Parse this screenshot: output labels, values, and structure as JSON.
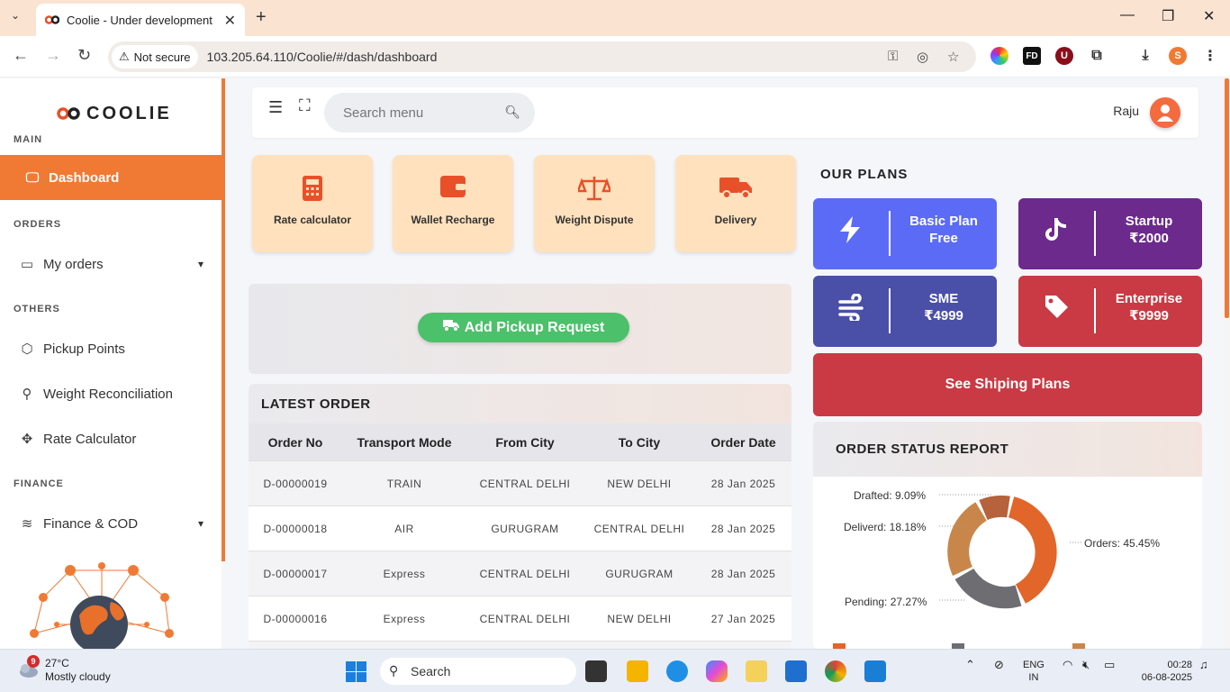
{
  "browser": {
    "tab_title": "Coolie - Under development",
    "security": "Not secure",
    "url": "103.205.64.110/Coolie/#/dash/dashboard",
    "profile_initial": "S"
  },
  "sidebar": {
    "brand": "COOLIE",
    "sections": {
      "main": "MAIN",
      "orders": "ORDERS",
      "others": "OTHERS",
      "finance": "FINANCE"
    },
    "items": {
      "dashboard": "Dashboard",
      "my_orders": "My orders",
      "pickup_points": "Pickup Points",
      "weight_reconciliation": "Weight Reconciliation",
      "rate_calculator": "Rate Calculator",
      "finance_cod": "Finance & COD"
    }
  },
  "header": {
    "search_placeholder": "Search menu",
    "user_name": "Raju"
  },
  "quick_actions": {
    "rate_calculator": "Rate calculator",
    "wallet_recharge": "Wallet Recharge",
    "weight_dispute": "Weight Dispute",
    "delivery": "Delivery"
  },
  "pickup": {
    "button_label": "Add Pickup Request"
  },
  "latest_order": {
    "title": "LATEST ORDER",
    "columns": [
      "Order No",
      "Transport Mode",
      "From City",
      "To City",
      "Order Date"
    ],
    "rows": [
      [
        "D-00000019",
        "TRAIN",
        "CENTRAL DELHI",
        "NEW DELHI",
        "28 Jan 2025"
      ],
      [
        "D-00000018",
        "AIR",
        "GURUGRAM",
        "CENTRAL DELHI",
        "28 Jan 2025"
      ],
      [
        "D-00000017",
        "Express",
        "CENTRAL DELHI",
        "GURUGRAM",
        "28 Jan 2025"
      ],
      [
        "D-00000016",
        "Express",
        "CENTRAL DELHI",
        "NEW DELHI",
        "27 Jan 2025"
      ]
    ]
  },
  "plans": {
    "title": "OUR PLANS",
    "basic": {
      "line1": "Basic Plan",
      "line2": "Free"
    },
    "startup": {
      "line1": "Startup",
      "line2": "₹2000"
    },
    "sme": {
      "line1": "SME",
      "line2": "₹4999"
    },
    "enterprise": {
      "line1": "Enterprise",
      "line2": "₹9999"
    },
    "see_plans": "See Shiping Plans",
    "colors": {
      "basic": "#5b6bf5",
      "startup": "#6c2a8c",
      "sme": "#4a4fa8",
      "enterprise": "#c93a44"
    }
  },
  "order_status": {
    "title": "ORDER STATUS REPORT",
    "labels": {
      "drafted": "Drafted: 9.09%",
      "delivered": "Deliverd: 18.18%",
      "orders": "Orders: 45.45%",
      "pending": "Pending: 27.27%"
    }
  },
  "taskbar": {
    "weather_temp": "27°C",
    "weather_desc": "Mostly cloudy",
    "weather_badge": "9",
    "search": "Search",
    "lang1": "ENG",
    "lang2": "IN",
    "time": "00:28",
    "date": "06-08-2025"
  }
}
